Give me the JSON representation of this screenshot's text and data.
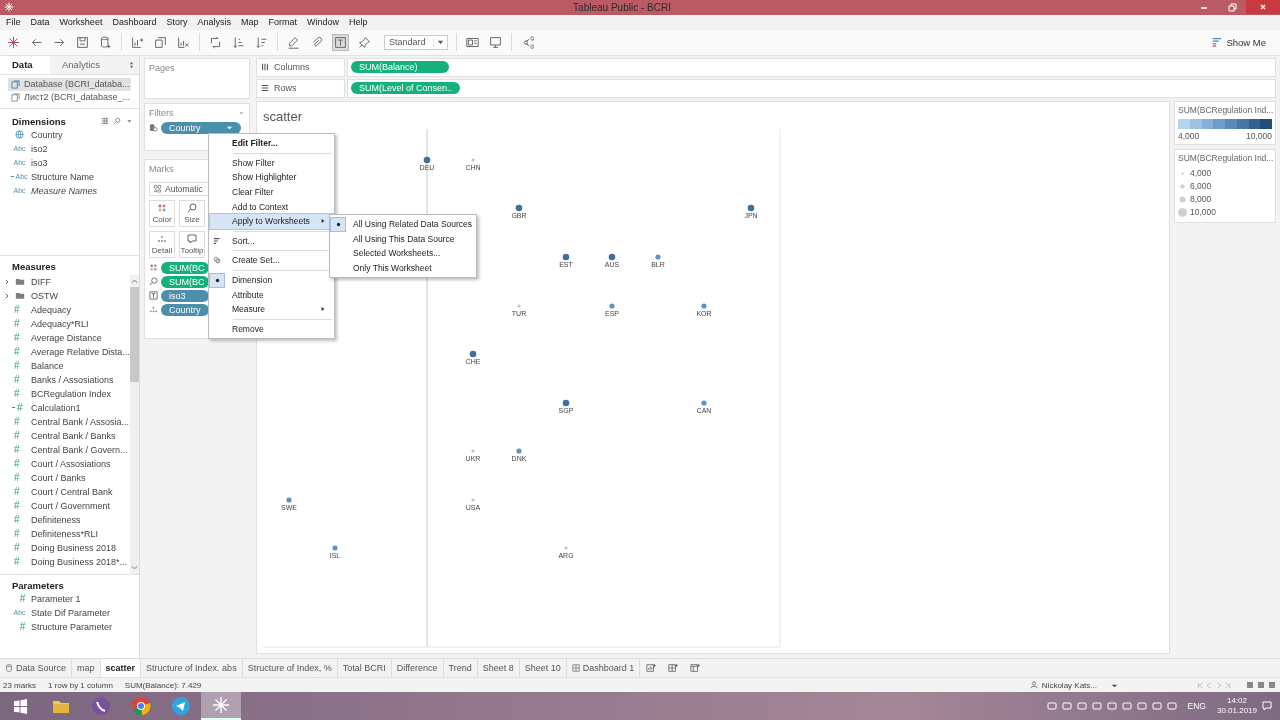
{
  "window": {
    "title": "Tableau Public - BCRI"
  },
  "menu": [
    "File",
    "Data",
    "Worksheet",
    "Dashboard",
    "Story",
    "Analysis",
    "Map",
    "Format",
    "Window",
    "Help"
  ],
  "toolbar": {
    "mark_style": "Standard",
    "show_me": "Show Me"
  },
  "data_pane": {
    "tabs": [
      {
        "label": "Data",
        "selected": true
      },
      {
        "label": "Analytics",
        "selected": false
      }
    ],
    "sources": [
      {
        "label": "Database (BCRI_databa...",
        "selected": true
      },
      {
        "label": "Лист2 (BCRI_database_...",
        "selected": false
      }
    ],
    "dimensions": {
      "title": "Dimensions",
      "items": [
        {
          "name": "Country",
          "kind": "geo",
          "calc": false,
          "generated": false
        },
        {
          "name": "iso2",
          "kind": "string",
          "glyph": "Abc",
          "calc": false,
          "generated": false
        },
        {
          "name": "iso3",
          "kind": "string",
          "glyph": "Abc",
          "calc": false,
          "generated": false
        },
        {
          "name": "Structure Name",
          "kind": "string",
          "glyph": "Abc",
          "calc": true,
          "generated": false
        },
        {
          "name": "Measure Names",
          "kind": "string",
          "glyph": "Abc",
          "calc": false,
          "generated": true
        }
      ]
    },
    "measures": {
      "title": "Measures",
      "items": [
        {
          "name": "DIFF",
          "kind": "folder",
          "expanded": false
        },
        {
          "name": "OSTW",
          "kind": "folder",
          "expanded": false
        },
        {
          "name": "Adequacy",
          "kind": "number",
          "glyph": "#",
          "calc": false
        },
        {
          "name": "Adequacy*RLI",
          "kind": "number",
          "glyph": "#",
          "calc": false
        },
        {
          "name": "Average Distance",
          "kind": "number",
          "glyph": "#",
          "calc": false
        },
        {
          "name": "Average Relative Dista...",
          "kind": "number",
          "glyph": "#",
          "calc": false
        },
        {
          "name": "Balance",
          "kind": "number",
          "glyph": "#",
          "calc": false
        },
        {
          "name": "Banks / Assosiations",
          "kind": "number",
          "glyph": "#",
          "calc": false
        },
        {
          "name": "BCRegulation Index",
          "kind": "number",
          "glyph": "#",
          "calc": false
        },
        {
          "name": "Calculation1",
          "kind": "number",
          "glyph": "#",
          "calc": true
        },
        {
          "name": "Central Bank / Assosia...",
          "kind": "number",
          "glyph": "#",
          "calc": false
        },
        {
          "name": "Central Bank / Banks",
          "kind": "number",
          "glyph": "#",
          "calc": false
        },
        {
          "name": "Central Bank / Govern...",
          "kind": "number",
          "glyph": "#",
          "calc": false
        },
        {
          "name": "Court / Assosiations",
          "kind": "number",
          "glyph": "#",
          "calc": false
        },
        {
          "name": "Court / Banks",
          "kind": "number",
          "glyph": "#",
          "calc": false
        },
        {
          "name": "Court / Central Bank",
          "kind": "number",
          "glyph": "#",
          "calc": false
        },
        {
          "name": "Court / Government",
          "kind": "number",
          "glyph": "#",
          "calc": false
        },
        {
          "name": "Definiteness",
          "kind": "number",
          "glyph": "#",
          "calc": false
        },
        {
          "name": "Definiteness*RLI",
          "kind": "number",
          "glyph": "#",
          "calc": false
        },
        {
          "name": "Doing Business 2018",
          "kind": "number",
          "glyph": "#",
          "calc": false
        },
        {
          "name": "Doing Business 2018*...",
          "kind": "number",
          "glyph": "#",
          "calc": false
        }
      ]
    },
    "parameters": {
      "title": "Parameters",
      "items": [
        {
          "name": "Parameter 1",
          "glyph": "#"
        },
        {
          "name": "State Dif Parameter",
          "glyph": "Abc"
        },
        {
          "name": "Structure Parameter",
          "glyph": "#"
        }
      ]
    }
  },
  "cards": {
    "pages": "Pages",
    "filters": {
      "title": "Filters",
      "pills": [
        {
          "label": "Country",
          "color": "#4b8fad"
        }
      ]
    },
    "marks": {
      "title": "Marks",
      "mark_type": "Automatic",
      "buttons": [
        {
          "label": "Color",
          "kind": "color"
        },
        {
          "label": "Size",
          "kind": "size"
        },
        {
          "label": "Detail",
          "kind": "detail"
        },
        {
          "label": "Tooltip",
          "kind": "tooltip"
        }
      ],
      "pills": [
        {
          "label": "SUM(BC",
          "kind": "color",
          "color": "#14b27a"
        },
        {
          "label": "SUM(BC",
          "kind": "size",
          "color": "#14b27a"
        },
        {
          "label": "iso3",
          "kind": "label",
          "color": "#4b8fad"
        },
        {
          "label": "Country",
          "kind": "detail",
          "color": "#4b8fad"
        }
      ]
    }
  },
  "shelves": [
    {
      "label": "Columns",
      "kind": "columns",
      "pill": "SUM(Balance)"
    },
    {
      "label": "Rows",
      "kind": "rows",
      "pill": "SUM(Level of Consen.."
    }
  ],
  "sheet": {
    "title": "scatter",
    "marks": [
      {
        "label": "DEU"
      },
      {
        "label": "CHN"
      },
      {
        "label": "GBR"
      },
      {
        "label": "JPN"
      },
      {
        "label": "EST"
      },
      {
        "label": "AUS"
      },
      {
        "label": "BLR"
      },
      {
        "label": "TUR"
      },
      {
        "label": "ESP"
      },
      {
        "label": "KOR"
      },
      {
        "label": "CHE"
      },
      {
        "label": "SGP"
      },
      {
        "label": "CAN"
      },
      {
        "label": "UKR"
      },
      {
        "label": "DNK"
      },
      {
        "label": "SWE"
      },
      {
        "label": "USA"
      },
      {
        "label": "ISL"
      },
      {
        "label": "ARG"
      }
    ]
  },
  "legends": {
    "color": {
      "title": "SUM(BCRegulation Ind...",
      "min": "4,000",
      "max": "10,000"
    },
    "size": {
      "title": "SUM(BCRegulation Ind...",
      "items": [
        "4,000",
        "6,000",
        "8,000",
        "10,000"
      ]
    }
  },
  "context_menu": {
    "groups": [
      [
        {
          "label": "Edit Filter...",
          "kind": "default",
          "selected": false,
          "checked": false
        }
      ],
      [
        {
          "label": "Show Filter",
          "kind": "item",
          "selected": false,
          "checked": false
        },
        {
          "label": "Show Highlighter",
          "kind": "item",
          "selected": false,
          "checked": false
        },
        {
          "label": "Clear Filter",
          "kind": "item",
          "selected": false,
          "checked": false
        },
        {
          "label": "Add to Context",
          "kind": "item",
          "selected": false,
          "checked": false
        },
        {
          "label": "Apply to Worksheets",
          "kind": "submenu",
          "selected": true,
          "checked": false
        }
      ],
      [
        {
          "label": "Sort...",
          "kind": "item",
          "selected": false,
          "checked": false
        }
      ],
      [
        {
          "label": "Create Set...",
          "kind": "item",
          "selected": false,
          "checked": false
        }
      ],
      [
        {
          "label": "Dimension",
          "kind": "item",
          "selected": false,
          "checked": true
        },
        {
          "label": "Attribute",
          "kind": "item",
          "selected": false,
          "checked": false
        },
        {
          "label": "Measure",
          "kind": "submenu",
          "selected": false,
          "checked": false
        }
      ],
      [
        {
          "label": "Remove",
          "kind": "item",
          "selected": false,
          "checked": false
        }
      ]
    ]
  },
  "submenu": {
    "items": [
      {
        "label": "All Using Related Data Sources",
        "checked": true
      },
      {
        "label": "All Using This Data Source",
        "checked": false
      },
      {
        "label": "Selected Worksheets...",
        "checked": false
      },
      {
        "label": "Only This Worksheet",
        "checked": false
      }
    ]
  },
  "sheet_tabs": [
    {
      "label": "Data Source",
      "kind": "datasource",
      "selected": false
    },
    {
      "label": "map",
      "kind": "sheet",
      "selected": false
    },
    {
      "label": "scatter",
      "kind": "sheet",
      "selected": true
    },
    {
      "label": "Structure of Index. abs",
      "kind": "sheet",
      "selected": false
    },
    {
      "label": "Structure of Index, %",
      "kind": "sheet",
      "selected": false
    },
    {
      "label": "Total BCRI",
      "kind": "sheet",
      "selected": false
    },
    {
      "label": "Difference",
      "kind": "sheet",
      "selected": false
    },
    {
      "label": "Trend",
      "kind": "sheet",
      "selected": false
    },
    {
      "label": "Sheet 8",
      "kind": "sheet",
      "selected": false
    },
    {
      "label": "Sheet 10",
      "kind": "sheet",
      "selected": false
    },
    {
      "label": "Dashboard 1",
      "kind": "dashboard",
      "selected": false
    }
  ],
  "status_bar": {
    "marks": "23 marks",
    "layout": "1 row by 1 column",
    "summary": "SUM(Balance): 7.429",
    "user": "Nickolay Kats..."
  },
  "taskbar": {
    "apps": [
      {
        "kind": "explorer",
        "selected": false
      },
      {
        "kind": "viber",
        "selected": false
      },
      {
        "kind": "chrome",
        "selected": false
      },
      {
        "kind": "telegram",
        "selected": false
      },
      {
        "kind": "tableau",
        "selected": true
      }
    ],
    "language": "ENG",
    "time": "14:02",
    "date": "30.01.2019"
  }
}
